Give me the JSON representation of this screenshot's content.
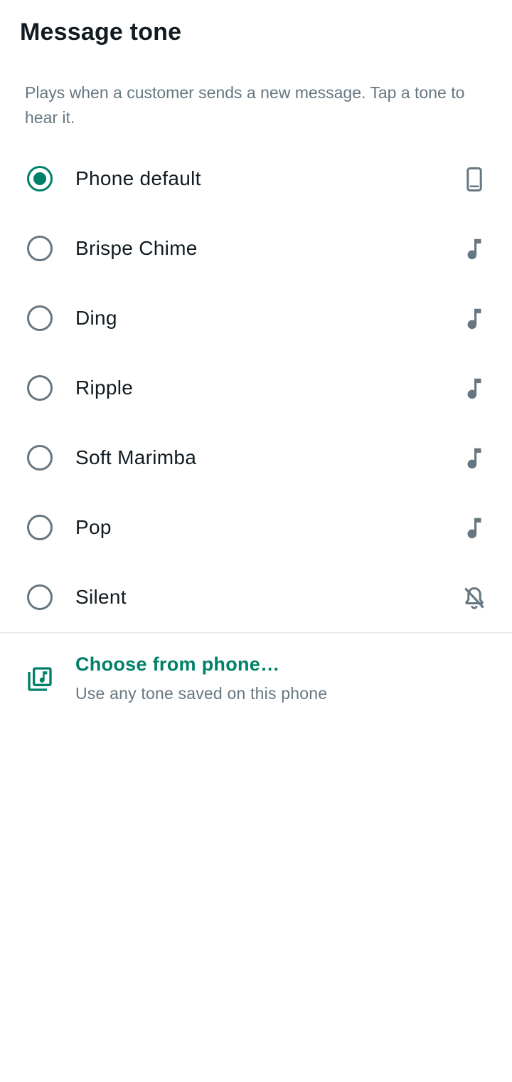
{
  "header": {
    "title": "Message tone",
    "description": "Plays when a customer sends a new message. Tap a tone to hear it."
  },
  "tones": [
    {
      "label": "Phone default",
      "selected": true,
      "icon": "phone-icon"
    },
    {
      "label": "Brispe Chime",
      "selected": false,
      "icon": "music-note-icon"
    },
    {
      "label": "Ding",
      "selected": false,
      "icon": "music-note-icon"
    },
    {
      "label": "Ripple",
      "selected": false,
      "icon": "music-note-icon"
    },
    {
      "label": "Soft Marimba",
      "selected": false,
      "icon": "music-note-icon"
    },
    {
      "label": "Pop",
      "selected": false,
      "icon": "music-note-icon"
    },
    {
      "label": "Silent",
      "selected": false,
      "icon": "bell-off-icon"
    }
  ],
  "choose_from_phone": {
    "title": "Choose from phone…",
    "subtitle": "Use any tone saved on this phone",
    "icon": "music-library-icon"
  },
  "colors": {
    "accent": "#008069",
    "text_primary": "#111b21",
    "text_secondary": "#667781",
    "divider": "#e9edef"
  }
}
